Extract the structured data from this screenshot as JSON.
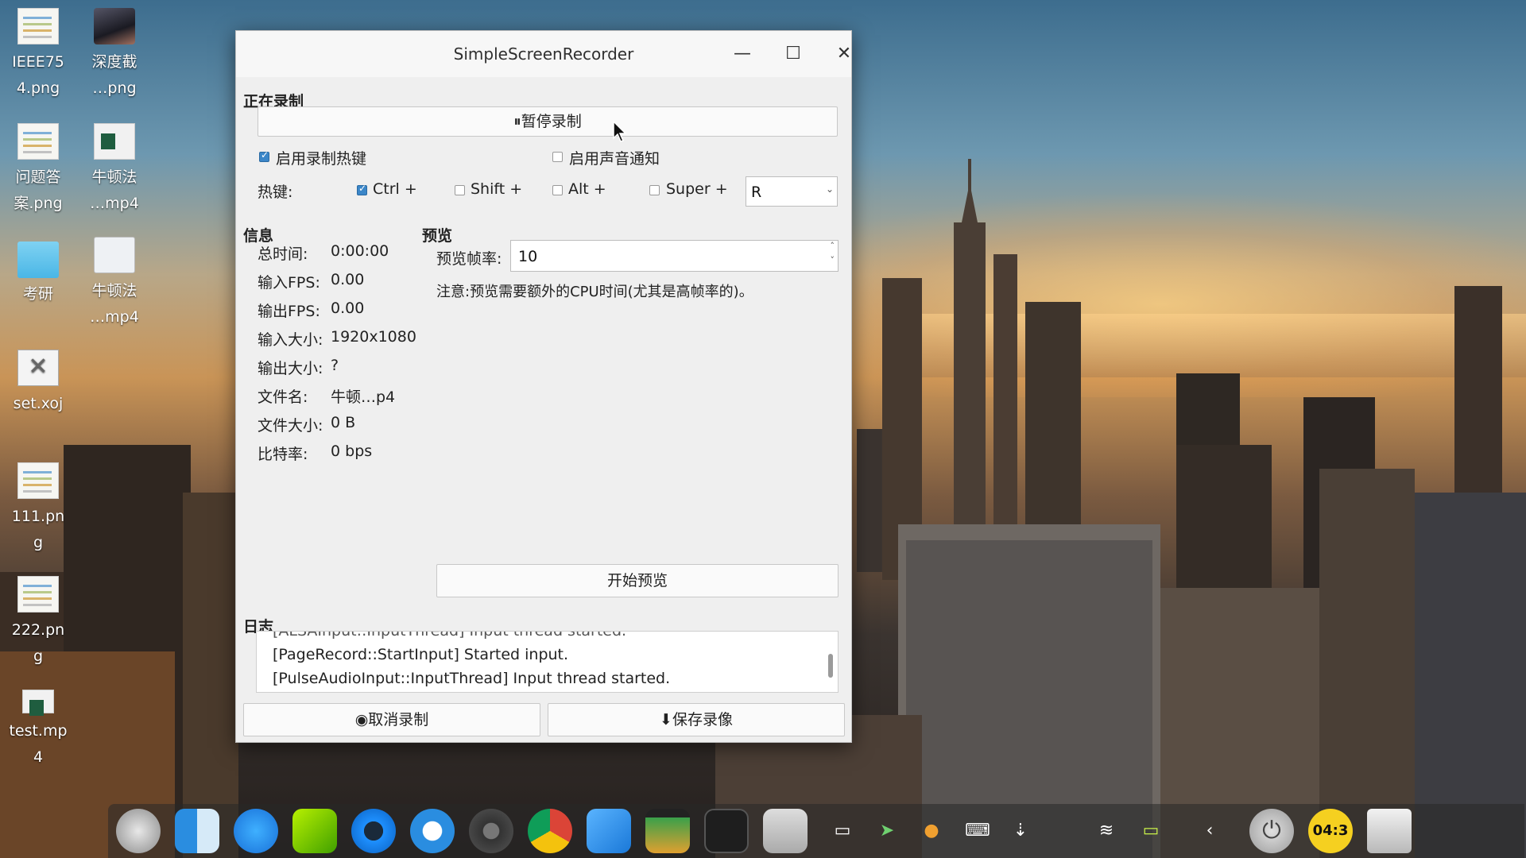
{
  "desktop": {
    "icons": [
      {
        "label": "IEEE754.png",
        "line1": "IEEE75",
        "line2": "4.png"
      },
      {
        "label": "深度截…png",
        "line1": "深度截",
        "line2": "…png"
      },
      {
        "label": "问题答案.png",
        "line1": "问题答",
        "line2": "案.png"
      },
      {
        "label": "牛顿法…mp4",
        "line1": "牛顿法",
        "line2": "…mp4"
      },
      {
        "label": "考研",
        "line1": "考研",
        "line2": ""
      },
      {
        "label": "牛顿法…mp4",
        "line1": "牛顿法",
        "line2": "…mp4"
      },
      {
        "label": "set.xoj",
        "line1": "set.xoj",
        "line2": ""
      },
      {
        "label": "111.png",
        "line1": "111.pn",
        "line2": "g"
      },
      {
        "label": "222.png",
        "line1": "222.pn",
        "line2": "g"
      },
      {
        "label": "test.mp4",
        "line1": "test.mp",
        "line2": "4"
      }
    ]
  },
  "window": {
    "title": "SimpleScreenRecorder",
    "controls": {
      "minimize": "—",
      "maximize": "☐",
      "close": "✕"
    },
    "recording": {
      "section_label": "正在录制",
      "pause_button": "⏸暂停录制",
      "enable_hotkey_label": "启用录制热键",
      "enable_hotkey_checked": true,
      "enable_sound_label": "启用声音通知",
      "enable_sound_checked": false,
      "hotkey_label": "热键:",
      "modifiers": {
        "ctrl": {
          "label": "Ctrl +",
          "checked": true
        },
        "shift": {
          "label": "Shift +",
          "checked": false
        },
        "alt": {
          "label": "Alt +",
          "checked": false
        },
        "super": {
          "label": "Super +",
          "checked": false
        }
      },
      "key_value": "R"
    },
    "info": {
      "section_label": "信息",
      "rows": [
        {
          "label": "总时间:",
          "value": "0:00:00"
        },
        {
          "label": "输入FPS:",
          "value": "0.00"
        },
        {
          "label": "输出FPS:",
          "value": "0.00"
        },
        {
          "label": "输入大小:",
          "value": "1920x1080"
        },
        {
          "label": "输出大小:",
          "value": "?"
        },
        {
          "label": "文件名:",
          "value": "牛顿…p4"
        },
        {
          "label": "文件大小:",
          "value": "0 B"
        },
        {
          "label": "比特率:",
          "value": "0 bps"
        }
      ]
    },
    "preview": {
      "section_label": "预览",
      "framerate_label": "预览帧率:",
      "framerate_value": "10",
      "note": "注意:预览需要额外的CPU时间(尤其是高帧率的)。",
      "start_button": "开始预览"
    },
    "log": {
      "section_label": "日志",
      "lines": [
        "[ALSAInput::InputThread] Input thread started.",
        "[PageRecord::StartInput] Started input.",
        "[PulseAudioInput::InputThread] Input thread started."
      ]
    },
    "bottom": {
      "cancel_button": "◉取消录制",
      "save_button": "⬇保存录像"
    }
  },
  "dock": {
    "apps": [
      "launcher-icon",
      "finder-icon",
      "app-store-icon",
      "music-icon",
      "browser-icon",
      "deepin-icon",
      "system-settings-icon",
      "chrome-icon",
      "app-icon",
      "monitor-icon",
      "terminal-icon",
      "screen-recorder-icon"
    ],
    "tray": [
      "notes-icon",
      "send-icon",
      "updates-icon",
      "keyboard-icon",
      "usb-icon",
      "wifi-icon",
      "battery-icon",
      "chevron-left-icon"
    ],
    "clock_text": "04:3",
    "power_label": "⏻"
  }
}
